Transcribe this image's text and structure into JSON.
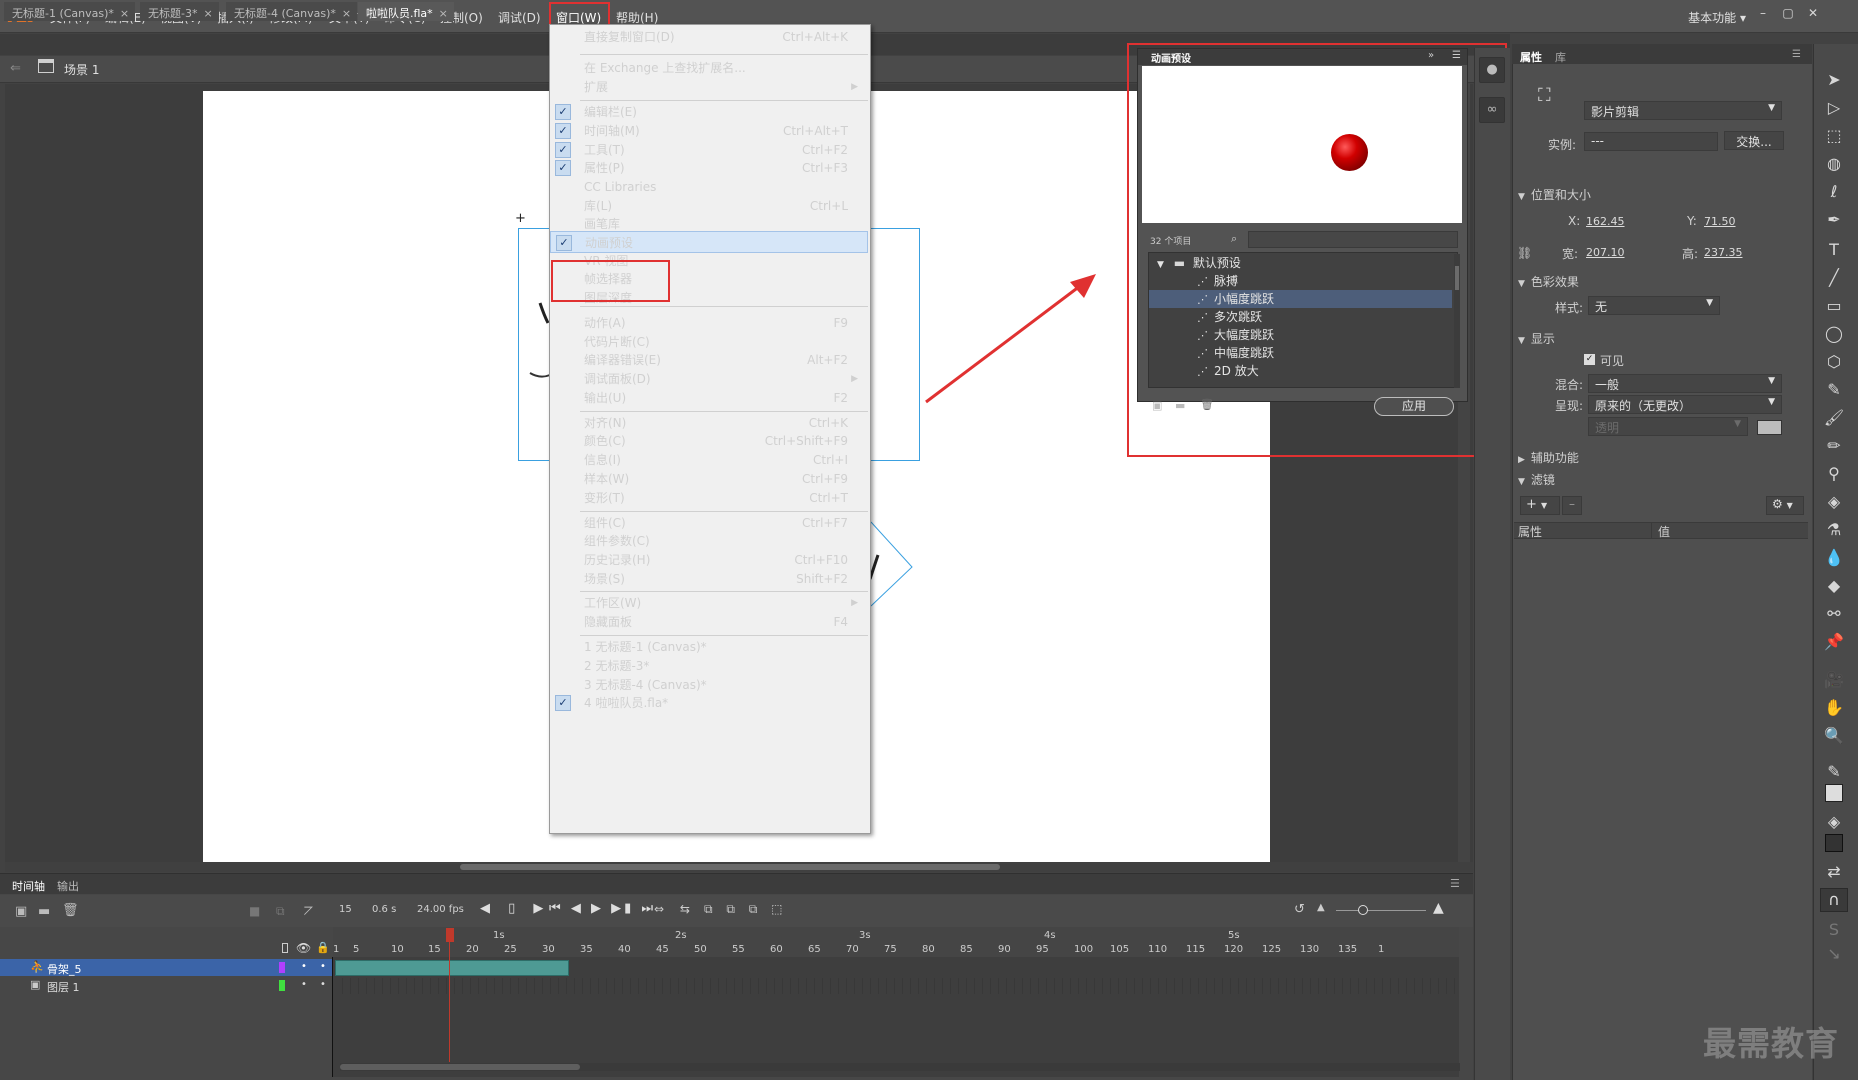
{
  "app": {
    "logo": "An",
    "workspace": "基本功能"
  },
  "menubar": [
    "文件(F)",
    "编辑(E)",
    "视图(V)",
    "插入(I)",
    "修改(M)",
    "文本(T)",
    "命令(C)",
    "控制(O)",
    "调试(D)",
    "窗口(W)",
    "帮助(H)"
  ],
  "doc_tabs": [
    "无标题-1 (Canvas)*",
    "无标题-3*",
    "无标题-4 (Canvas)*",
    "啦啦队员.fla*"
  ],
  "scene": {
    "label": "场景 1"
  },
  "window_menu": {
    "items": [
      {
        "label": "直接复制窗口(D)",
        "shortcut": "Ctrl+Alt+K"
      },
      {
        "label": "在 Exchange 上查找扩展名..."
      },
      {
        "label": "扩展"
      },
      {
        "label": "编辑栏(E)"
      },
      {
        "label": "时间轴(M)",
        "shortcut": "Ctrl+Alt+T"
      },
      {
        "label": "工具(T)",
        "shortcut": "Ctrl+F2"
      },
      {
        "label": "属性(P)",
        "shortcut": "Ctrl+F3"
      },
      {
        "label": "CC Libraries"
      },
      {
        "label": "库(L)",
        "shortcut": "Ctrl+L"
      },
      {
        "label": "画笔库"
      },
      {
        "label": "动画预设"
      },
      {
        "label": "VR 视图"
      },
      {
        "label": "帧选择器"
      },
      {
        "label": "图层深度"
      },
      {
        "label": "动作(A)",
        "shortcut": "F9"
      },
      {
        "label": "代码片断(C)"
      },
      {
        "label": "编译器错误(E)",
        "shortcut": "Alt+F2"
      },
      {
        "label": "调试面板(D)"
      },
      {
        "label": "输出(U)",
        "shortcut": "F2"
      },
      {
        "label": "对齐(N)",
        "shortcut": "Ctrl+K"
      },
      {
        "label": "颜色(C)",
        "shortcut": "Ctrl+Shift+F9"
      },
      {
        "label": "信息(I)",
        "shortcut": "Ctrl+I"
      },
      {
        "label": "样本(W)",
        "shortcut": "Ctrl+F9"
      },
      {
        "label": "变形(T)",
        "shortcut": "Ctrl+T"
      },
      {
        "label": "组件(C)",
        "shortcut": "Ctrl+F7"
      },
      {
        "label": "组件参数(C)"
      },
      {
        "label": "历史记录(H)",
        "shortcut": "Ctrl+F10"
      },
      {
        "label": "场景(S)",
        "shortcut": "Shift+F2"
      },
      {
        "label": "工作区(W)"
      },
      {
        "label": "隐藏面板",
        "shortcut": "F4"
      },
      {
        "label": "1 无标题-1 (Canvas)*"
      },
      {
        "label": "2 无标题-3*"
      },
      {
        "label": "3 无标题-4 (Canvas)*"
      },
      {
        "label": "4 啦啦队员.fla*"
      }
    ],
    "check_mark": "✓"
  },
  "preset_panel": {
    "title": "动画预设",
    "count": "32 个项目",
    "folder": "默认预设",
    "items": [
      "脉搏",
      "小幅度跳跃",
      "多次跳跃",
      "大幅度跳跃",
      "中幅度跳跃",
      "2D 放大"
    ],
    "selected": "小幅度跳跃",
    "apply": "应用",
    "ball_color": "#d10000"
  },
  "properties": {
    "tabs": [
      "属性",
      "库"
    ],
    "instance_type": "影片剪辑",
    "instance_label": "实例:",
    "instance_value": "---",
    "swap": "交换...",
    "section_pos": "位置和大小",
    "x_label": "X:",
    "x": "162.45",
    "y_label": "Y:",
    "y": "71.50",
    "w_label": "宽:",
    "w": "207.10",
    "h_label": "高:",
    "h": "237.35",
    "section_color": "色彩效果",
    "style_label": "样式:",
    "style": "无",
    "section_display": "显示",
    "visible": "可见",
    "blend_label": "混合:",
    "blend": "一般",
    "render_label": "呈现:",
    "render": "原来的（无更改）",
    "transparent": "透明",
    "section_access": "辅助功能",
    "section_filter": "滤镜",
    "col_prop": "属性",
    "col_val": "值"
  },
  "timeline": {
    "tabs": [
      "时间轴",
      "输出"
    ],
    "frame": "15",
    "time": "0.6 s",
    "fps": "24.00 fps",
    "seconds": [
      "1s",
      "2s",
      "3s",
      "4s",
      "5s"
    ],
    "frame_ticks": [
      "1",
      "5",
      "10",
      "15",
      "20",
      "25",
      "30",
      "35",
      "40",
      "45",
      "50",
      "55",
      "60",
      "65",
      "70",
      "75",
      "80",
      "85",
      "90",
      "95",
      "100",
      "105",
      "110",
      "115",
      "120",
      "125",
      "130",
      "135",
      "1"
    ],
    "layers": [
      {
        "name": "骨架_5",
        "color": "#b040ff"
      },
      {
        "name": "图层 1",
        "color": "#40e040"
      }
    ]
  },
  "watermark": "最需教育",
  "accent": "#e03131"
}
